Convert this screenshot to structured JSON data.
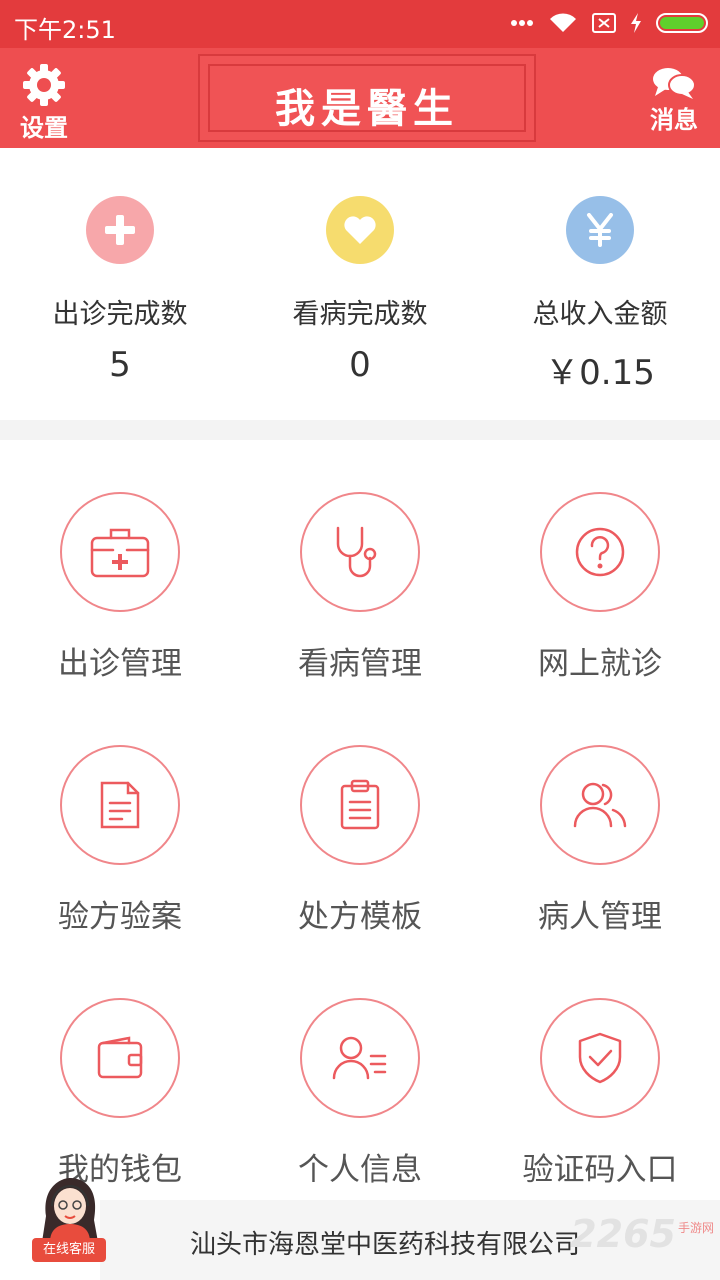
{
  "status_bar": {
    "time": "下午2:51",
    "battery_level": 1.0
  },
  "header": {
    "settings_label": "设置",
    "title": "我是醫生",
    "messages_label": "消息"
  },
  "stats": [
    {
      "icon": "plus-icon",
      "color": "#f7a7aa",
      "label": "出诊完成数",
      "value": "5"
    },
    {
      "icon": "heart-icon",
      "color": "#f6dc6e",
      "label": "看病完成数",
      "value": "0"
    },
    {
      "icon": "yen-icon",
      "color": "#97bfe8",
      "label": "总收入金额",
      "value": "￥0.15"
    }
  ],
  "grid": [
    {
      "icon": "medical-kit-icon",
      "label": "出诊管理"
    },
    {
      "icon": "stethoscope-icon",
      "label": "看病管理"
    },
    {
      "icon": "question-icon",
      "label": "网上就诊"
    },
    {
      "icon": "document-icon",
      "label": "验方验案"
    },
    {
      "icon": "clipboard-icon",
      "label": "处方模板"
    },
    {
      "icon": "patients-icon",
      "label": "病人管理"
    },
    {
      "icon": "wallet-icon",
      "label": "我的钱包"
    },
    {
      "icon": "profile-icon",
      "label": "个人信息"
    },
    {
      "icon": "shield-check-icon",
      "label": "验证码入口"
    }
  ],
  "footer": {
    "company": "汕头市海恩堂中医药科技有限公司",
    "customer_service": "在线客服",
    "watermark": "2265",
    "watermark_sub": "手游网"
  },
  "colors": {
    "status_bar": "#e33b3d",
    "header": "#ee4e50",
    "icon_stroke": "#ec5a5e",
    "circle_border": "#f0868a"
  }
}
